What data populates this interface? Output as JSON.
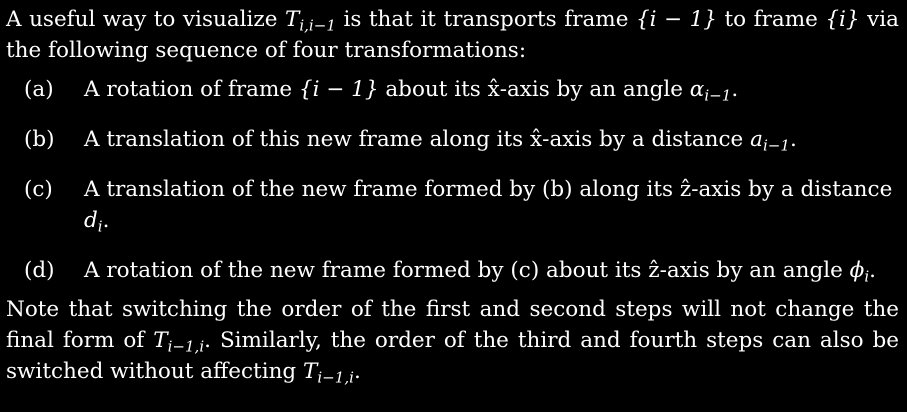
{
  "intro": {
    "t1": "A useful way to visualize ",
    "T": "T",
    "T_sub": "i,i−1",
    "t2": " is that it transports frame ",
    "frame_from": "{i − 1}",
    "t3": " to frame ",
    "frame_to": "{i}",
    "t4": " via the following sequence of four transformations:"
  },
  "items": [
    {
      "label": "(a)",
      "t1": "A rotation of frame ",
      "frame": "{i − 1}",
      "t2": " about its x̂-axis by an angle ",
      "sym": "α",
      "sym_sub": "i−1",
      "t3": "."
    },
    {
      "label": "(b)",
      "t1": "A translation of this new frame along its x̂-axis by a distance ",
      "sym": "a",
      "sym_sub": "i−1",
      "t2": "."
    },
    {
      "label": "(c)",
      "t1": "A translation of the new frame formed by (b) along its ẑ-axis by a distance ",
      "sym": "d",
      "sym_sub": "i",
      "t2": "."
    },
    {
      "label": "(d)",
      "t1": "A rotation of the new frame formed by (c) about its ẑ-axis by an angle ",
      "sym": "ϕ",
      "sym_sub": "i",
      "t2": "."
    }
  ],
  "outro": {
    "t1": "Note that switching the order of the first and second steps will not change the final form of ",
    "T1": "T",
    "T1_sub": "i−1,i",
    "t2": ". Similarly, the order of the third and fourth steps can also be switched without affecting ",
    "T2": "T",
    "T2_sub": "i−1,i",
    "t3": "."
  }
}
